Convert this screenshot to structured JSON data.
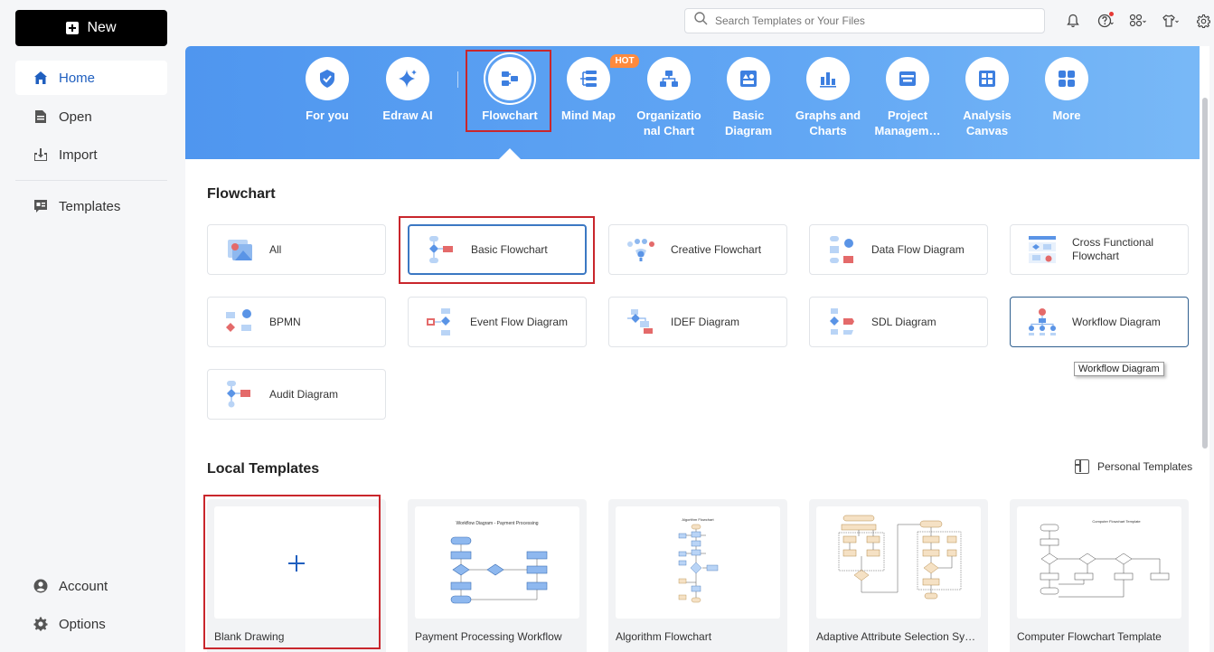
{
  "sidebar": {
    "new_label": "New",
    "items": [
      {
        "label": "Home",
        "icon": "home-icon"
      },
      {
        "label": "Open",
        "icon": "document-icon"
      },
      {
        "label": "Import",
        "icon": "import-icon"
      },
      {
        "label": "Templates",
        "icon": "templates-icon"
      },
      {
        "label": "Account",
        "icon": "account-icon"
      },
      {
        "label": "Options",
        "icon": "gear-icon"
      }
    ]
  },
  "search": {
    "placeholder": "Search Templates or Your Files"
  },
  "banner": {
    "hot_badge": "HOT",
    "categories": [
      {
        "label": "For you",
        "icon": "for-you-icon"
      },
      {
        "label": "Edraw AI",
        "icon": "sparkle-icon"
      },
      {
        "label": "Flowchart",
        "icon": "flowchart-icon"
      },
      {
        "label": "Mind Map",
        "icon": "mind-map-icon"
      },
      {
        "label": "Organizatio nal Chart",
        "icon": "org-chart-icon"
      },
      {
        "label": "Basic Diagram",
        "icon": "basic-diagram-icon"
      },
      {
        "label": "Graphs and Charts",
        "icon": "bar-chart-icon"
      },
      {
        "label": "Project Managem…",
        "icon": "project-icon"
      },
      {
        "label": "Analysis Canvas",
        "icon": "canvas-icon"
      },
      {
        "label": "More",
        "icon": "grid-icon"
      }
    ]
  },
  "flowchart": {
    "title": "Flowchart",
    "types": [
      "All",
      "Basic Flowchart",
      "Creative Flowchart",
      "Data Flow Diagram",
      "Cross Functional Flowchart",
      "BPMN",
      "Event Flow Diagram",
      "IDEF Diagram",
      "SDL Diagram",
      "Workflow Diagram",
      "Audit Diagram"
    ],
    "tooltip": "Workflow Diagram"
  },
  "local_templates": {
    "title": "Local Templates",
    "personal_label": "Personal Templates",
    "items": [
      {
        "name": "Blank Drawing",
        "thumb_title": ""
      },
      {
        "name": "Payment Processing Workflow",
        "thumb_title": "Workflow Diagram - Payment Processing"
      },
      {
        "name": "Algorithm Flowchart",
        "thumb_title": "Algorithm Flowchart"
      },
      {
        "name": "Adaptive Attribute Selection Syst…",
        "thumb_title": ""
      },
      {
        "name": "Computer Flowchart Template",
        "thumb_title": "Computer Flowchart Template"
      }
    ]
  },
  "colors": {
    "accent": "#1f5fbf",
    "banner": "#4f96ef",
    "highlight": "#c9262c",
    "diagram_blue": "#8eb8ef",
    "diagram_red": "#e46a6a"
  }
}
